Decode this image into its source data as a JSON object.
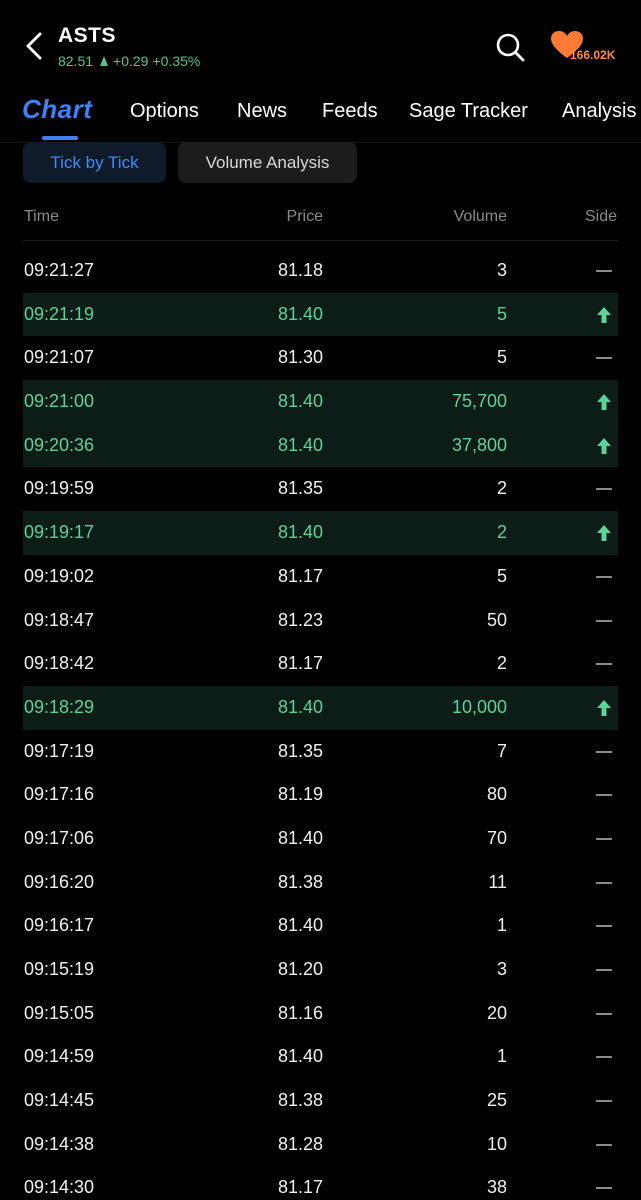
{
  "header": {
    "symbol": "ASTS",
    "price": "82.51",
    "change": "+0.29",
    "change_pct": "+0.35%",
    "likes": "166.02K",
    "up_color": "#4fc98d",
    "icons": [
      "back-arrow-icon",
      "search-icon",
      "heart-icon"
    ]
  },
  "tabs": [
    {
      "label": "Chart"
    },
    {
      "label": "Options"
    },
    {
      "label": "News"
    },
    {
      "label": "Feeds"
    },
    {
      "label": "Sage Tracker"
    },
    {
      "label": "Analysis"
    }
  ],
  "segments": {
    "active": "Tick by Tick",
    "inactive": "Volume Analysis"
  },
  "columns": {
    "time": "Time",
    "price": "Price",
    "volume": "Volume",
    "side": "Side"
  },
  "trades": [
    {
      "time": "09:21:27",
      "price": "81.18",
      "volume": "3",
      "side": "neutral"
    },
    {
      "time": "09:21:19",
      "price": "81.40",
      "volume": "5",
      "side": "buy"
    },
    {
      "time": "09:21:07",
      "price": "81.30",
      "volume": "5",
      "side": "neutral"
    },
    {
      "time": "09:21:00",
      "price": "81.40",
      "volume": "75,700",
      "side": "buy"
    },
    {
      "time": "09:20:36",
      "price": "81.40",
      "volume": "37,800",
      "side": "buy"
    },
    {
      "time": "09:19:59",
      "price": "81.35",
      "volume": "2",
      "side": "neutral"
    },
    {
      "time": "09:19:17",
      "price": "81.40",
      "volume": "2",
      "side": "buy"
    },
    {
      "time": "09:19:02",
      "price": "81.17",
      "volume": "5",
      "side": "neutral"
    },
    {
      "time": "09:18:47",
      "price": "81.23",
      "volume": "50",
      "side": "neutral"
    },
    {
      "time": "09:18:42",
      "price": "81.17",
      "volume": "2",
      "side": "neutral"
    },
    {
      "time": "09:18:29",
      "price": "81.40",
      "volume": "10,000",
      "side": "buy"
    },
    {
      "time": "09:17:19",
      "price": "81.35",
      "volume": "7",
      "side": "neutral"
    },
    {
      "time": "09:17:16",
      "price": "81.19",
      "volume": "80",
      "side": "neutral"
    },
    {
      "time": "09:17:06",
      "price": "81.40",
      "volume": "70",
      "side": "neutral"
    },
    {
      "time": "09:16:20",
      "price": "81.38",
      "volume": "11",
      "side": "neutral"
    },
    {
      "time": "09:16:17",
      "price": "81.40",
      "volume": "1",
      "side": "neutral"
    },
    {
      "time": "09:15:19",
      "price": "81.20",
      "volume": "3",
      "side": "neutral"
    },
    {
      "time": "09:15:05",
      "price": "81.16",
      "volume": "20",
      "side": "neutral"
    },
    {
      "time": "09:14:59",
      "price": "81.40",
      "volume": "1",
      "side": "neutral"
    },
    {
      "time": "09:14:45",
      "price": "81.38",
      "volume": "25",
      "side": "neutral"
    },
    {
      "time": "09:14:38",
      "price": "81.28",
      "volume": "10",
      "side": "neutral"
    },
    {
      "time": "09:14:30",
      "price": "81.17",
      "volume": "38",
      "side": "neutral"
    }
  ]
}
